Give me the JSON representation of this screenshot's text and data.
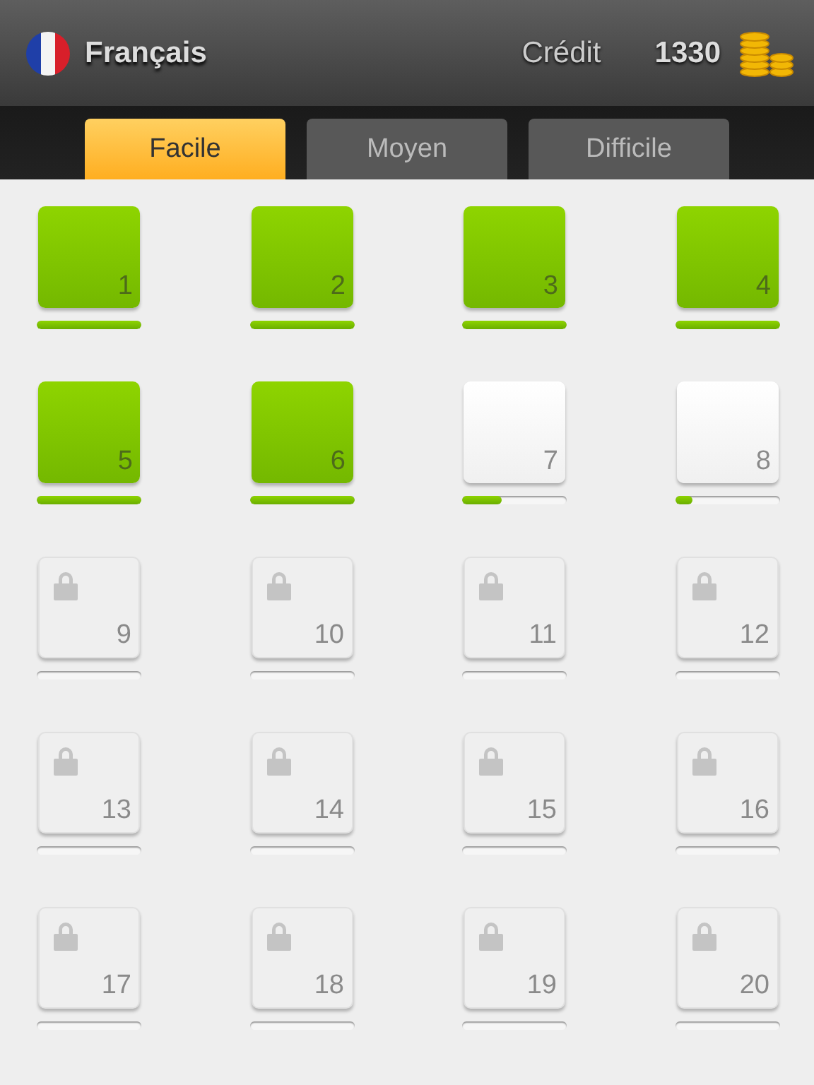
{
  "header": {
    "language": "Français",
    "credit_label": "Crédit",
    "credit": "1330"
  },
  "tabs": [
    {
      "label": "Facile",
      "selected": true
    },
    {
      "label": "Moyen",
      "selected": false
    },
    {
      "label": "Difficile",
      "selected": false
    }
  ],
  "levels": [
    {
      "number": "1",
      "kind": "done",
      "level": 1
    },
    {
      "number": "2",
      "kind": "done",
      "level": 1
    },
    {
      "number": "3",
      "kind": "done",
      "level": 1
    },
    {
      "number": "4",
      "kind": "done",
      "level": 1
    },
    {
      "number": "5",
      "kind": "done",
      "level": 1
    },
    {
      "number": "6",
      "kind": "done",
      "level": 1
    },
    {
      "number": "7",
      "kind": "open",
      "level": 0.38
    },
    {
      "number": "8",
      "kind": "open",
      "level": 0.17
    },
    {
      "number": "9",
      "kind": "locked",
      "level": 0
    },
    {
      "number": "10",
      "kind": "locked",
      "level": 0
    },
    {
      "number": "11",
      "kind": "locked",
      "level": 0
    },
    {
      "number": "12",
      "kind": "locked",
      "level": 0
    },
    {
      "number": "13",
      "kind": "locked",
      "level": 0
    },
    {
      "number": "14",
      "kind": "locked",
      "level": 0
    },
    {
      "number": "15",
      "kind": "locked",
      "level": 0
    },
    {
      "number": "16",
      "kind": "locked",
      "level": 0
    },
    {
      "number": "17",
      "kind": "locked",
      "level": 0
    },
    {
      "number": "18",
      "kind": "locked",
      "level": 0
    },
    {
      "number": "19",
      "kind": "locked",
      "level": 0
    },
    {
      "number": "20",
      "kind": "locked",
      "level": 0
    }
  ]
}
